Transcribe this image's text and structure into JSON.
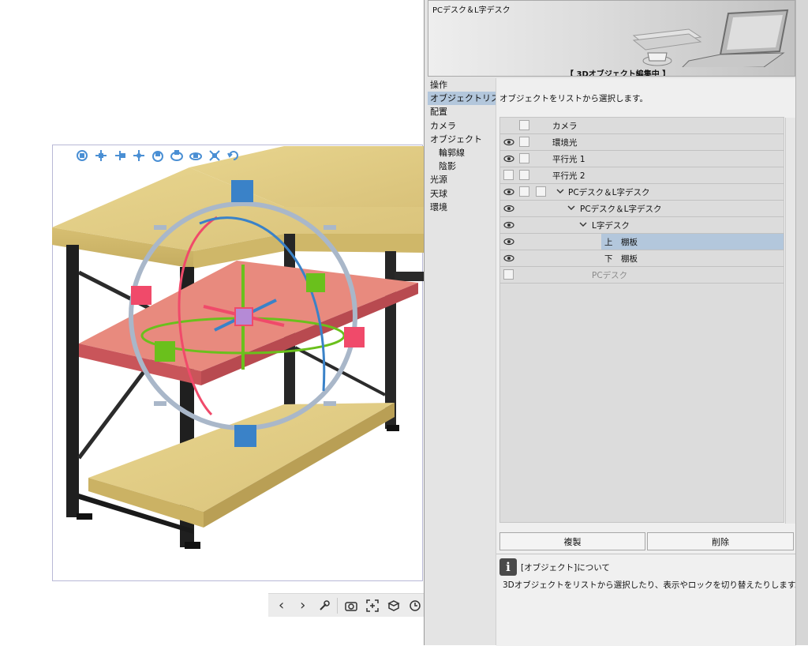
{
  "panel": {
    "title": "PCデスク＆L字デスク",
    "mode_label": "【 3Dオブジェクト編集中 】",
    "nav": [
      {
        "label": "操作",
        "selected": false,
        "sub": false
      },
      {
        "label": "オブジェクトリスト",
        "selected": true,
        "sub": false
      },
      {
        "label": "配置",
        "selected": false,
        "sub": false
      },
      {
        "label": "カメラ",
        "selected": false,
        "sub": false
      },
      {
        "label": "オブジェクト",
        "selected": false,
        "sub": false
      },
      {
        "label": "輪郭線",
        "selected": false,
        "sub": true
      },
      {
        "label": "陰影",
        "selected": false,
        "sub": true
      },
      {
        "label": "光源",
        "selected": false,
        "sub": false
      },
      {
        "label": "天球",
        "selected": false,
        "sub": false
      },
      {
        "label": "環境",
        "selected": false,
        "sub": false
      }
    ],
    "description": "オブジェクトをリストから選択します。",
    "object_list": [
      {
        "label": "カメラ",
        "eye": false,
        "cb1": true,
        "cb2": false,
        "chevron": false
      },
      {
        "label": "環境光",
        "eye": true,
        "cb1": true,
        "cb2": false,
        "chevron": false
      },
      {
        "label": "平行光 1",
        "eye": true,
        "cb1": true,
        "cb2": false,
        "chevron": false
      },
      {
        "label": "平行光 2",
        "eye": false,
        "cb1": true,
        "cb2": false,
        "chevron": false
      },
      {
        "label": "PCデスク＆L字デスク",
        "eye": true,
        "cb1": true,
        "cb2": true,
        "chevron": true
      },
      {
        "label": "PCデスク＆L字デスク",
        "eye": true,
        "cb1": false,
        "cb2": false,
        "chevron": true
      },
      {
        "label": "L字デスク",
        "eye": true,
        "cb1": false,
        "cb2": false,
        "chevron": true
      },
      {
        "label": "上　棚板",
        "eye": true,
        "cb1": false,
        "cb2": false,
        "chevron": false,
        "selected": true
      },
      {
        "label": "下　棚板",
        "eye": true,
        "cb1": false,
        "cb2": false,
        "chevron": false
      },
      {
        "label": "PCデスク",
        "eye": false,
        "cb1": false,
        "cb2": false,
        "chevron": false,
        "dim": true
      }
    ],
    "duplicate_label": "複製",
    "delete_label": "削除",
    "info": {
      "icon": "i",
      "title": "[オブジェクト]について",
      "text": "3Dオブジェクトをリストから選択したり、表示やロックを切り替えたりします。"
    }
  },
  "canvas": {
    "gizmo_tools": [
      "rotate-camera-icon",
      "pan-camera-icon",
      "dolly-camera-icon",
      "move-object-icon",
      "rotate-object-icon",
      "rotate-view-icon",
      "orbit-icon",
      "scale-icon",
      "reset-icon"
    ],
    "bottom_toolbar": [
      "previous-icon",
      "next-icon",
      "wrench-icon",
      "camera-icon",
      "fit-icon",
      "ground-icon",
      "clock-icon"
    ]
  },
  "colors": {
    "selection": "#b3c7dc",
    "wood": "#e3cf84",
    "selected_shelf": "#e58478",
    "frame": "#222222",
    "gizmo_blue": "#3a82c8",
    "gizmo_red": "#f04a6a",
    "gizmo_green": "#6ac01c",
    "gizmo_ring": "#a9b7c9"
  }
}
